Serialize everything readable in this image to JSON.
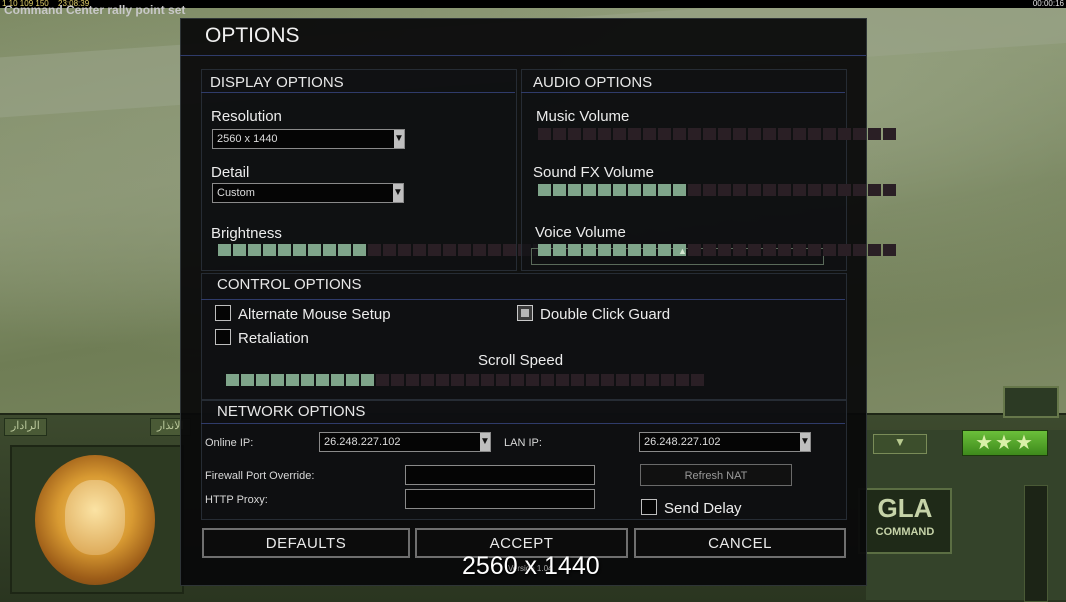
{
  "top_bar": {
    "status_message": "Command Center rally point set",
    "resources": "1 10 109 150",
    "clock_left": "23:08:39",
    "clock_right": "00:00:16"
  },
  "hud": {
    "tab_left": "الرادار",
    "tab_mid": "الانذار",
    "stars": "★★★",
    "emblem_top": "GLA",
    "emblem_bottom": "COMMAND"
  },
  "dialog": {
    "title": "OPTIONS",
    "display": {
      "header": "DISPLAY OPTIONS",
      "resolution_label": "Resolution",
      "resolution_value": "2560 x 1440",
      "detail_label": "Detail",
      "detail_value": "Custom",
      "brightness_label": "Brightness",
      "brightness_level": 10,
      "brightness_segments": 24
    },
    "audio": {
      "header": "AUDIO OPTIONS",
      "music_label": "Music Volume",
      "music_level": 0,
      "sfx_label": "Sound FX Volume",
      "sfx_level": 10,
      "voice_label": "Voice Volume",
      "voice_level": 10,
      "segments": 24
    },
    "control": {
      "header": "CONTROL OPTIONS",
      "alt_mouse_label": "Alternate Mouse Setup",
      "alt_mouse_checked": false,
      "retaliation_label": "Retaliation",
      "retaliation_checked": false,
      "double_click_label": "Double Click Guard",
      "double_click_checked": true,
      "scroll_label": "Scroll Speed",
      "scroll_level": 10,
      "scroll_segments": 32
    },
    "network": {
      "header": "NETWORK OPTIONS",
      "online_ip_label": "Online IP:",
      "online_ip_value": "26.248.227.102",
      "lan_ip_label": "LAN IP:",
      "lan_ip_value": "26.248.227.102",
      "firewall_label": "Firewall Port Override:",
      "firewall_value": "",
      "proxy_label": "HTTP Proxy:",
      "proxy_value": "",
      "refresh_nat_label": "Refresh NAT",
      "send_delay_label": "Send Delay",
      "send_delay_checked": false
    },
    "buttons": {
      "defaults": "DEFAULTS",
      "accept": "ACCEPT",
      "cancel": "CANCEL"
    }
  },
  "overlay": {
    "resolution_text": "2560 x 1440",
    "version_text": "Version 1.04"
  },
  "colors": {
    "slider_on": "#7fa58a",
    "slider_off": "#2a1f25",
    "divider": "#2f3b6a"
  }
}
